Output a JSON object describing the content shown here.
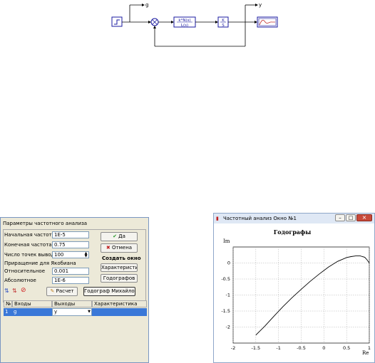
{
  "diagram": {
    "outputs": {
      "g": "g",
      "y": "y"
    },
    "transfer": {
      "numerator": "k*N(s)",
      "denominator": "L(s)"
    },
    "integrator": {
      "numerator": "K",
      "denominator": "S"
    },
    "colors": {
      "block_border": "#1a1aa0",
      "wire": "#000000"
    }
  },
  "dialog": {
    "title": "Параметры частотного анализа",
    "fields": {
      "start_freq_label": "Начальная частота",
      "start_freq_value": "1E-5",
      "end_freq_label": "Конечная частота",
      "end_freq_value": "0.75",
      "points_label": "Число точек вывода",
      "points_value": "100",
      "jacobian_label": "Приращение для Якобиана",
      "relative_label": "Относительное",
      "relative_value": "0.001",
      "absolute_label": "Абсолютное",
      "absolute_value": "1E-6"
    },
    "buttons": {
      "ok": "Да",
      "cancel": "Отмена",
      "create_window_label": "Создать окно",
      "characteristics": "Характеристик",
      "hodographs": "Годографов",
      "calc": "Расчет",
      "mikhailov": "Годограф Михайлова"
    },
    "grid": {
      "headers": [
        "№",
        "Входы",
        "Выходы",
        "Характеристика"
      ],
      "rows": [
        {
          "n": "1",
          "input": "g",
          "output": "y",
          "characteristic": ""
        }
      ]
    }
  },
  "chart_window": {
    "title": "Частотный анализ Окно №1",
    "buttons": {
      "minimize": "–",
      "maximize": "□",
      "close": "×"
    }
  },
  "chart_data": {
    "type": "line",
    "title": "Годографы",
    "xlabel": "Re",
    "ylabel": "Im",
    "xlim": [
      -2,
      1
    ],
    "ylim": [
      -2.5,
      0.5
    ],
    "xticks": [
      "-2",
      "-1.5",
      "-1",
      "-0.5",
      "0",
      "0.5",
      "1"
    ],
    "yticks": [
      "0",
      "-0.5",
      "-1",
      "-1.5",
      "-2"
    ],
    "grid": true,
    "series": [
      {
        "x": [
          -1.5,
          -1.3,
          -1.1,
          -0.9,
          -0.7,
          -0.5,
          -0.3,
          -0.1,
          0.1,
          0.3,
          0.5,
          0.6,
          0.7,
          0.8,
          0.9,
          0.95,
          1.0
        ],
        "y": [
          -2.25,
          -1.97,
          -1.66,
          -1.36,
          -1.08,
          -0.82,
          -0.57,
          -0.34,
          -0.13,
          0.05,
          0.17,
          0.2,
          0.22,
          0.22,
          0.18,
          0.1,
          0.0
        ]
      }
    ]
  }
}
